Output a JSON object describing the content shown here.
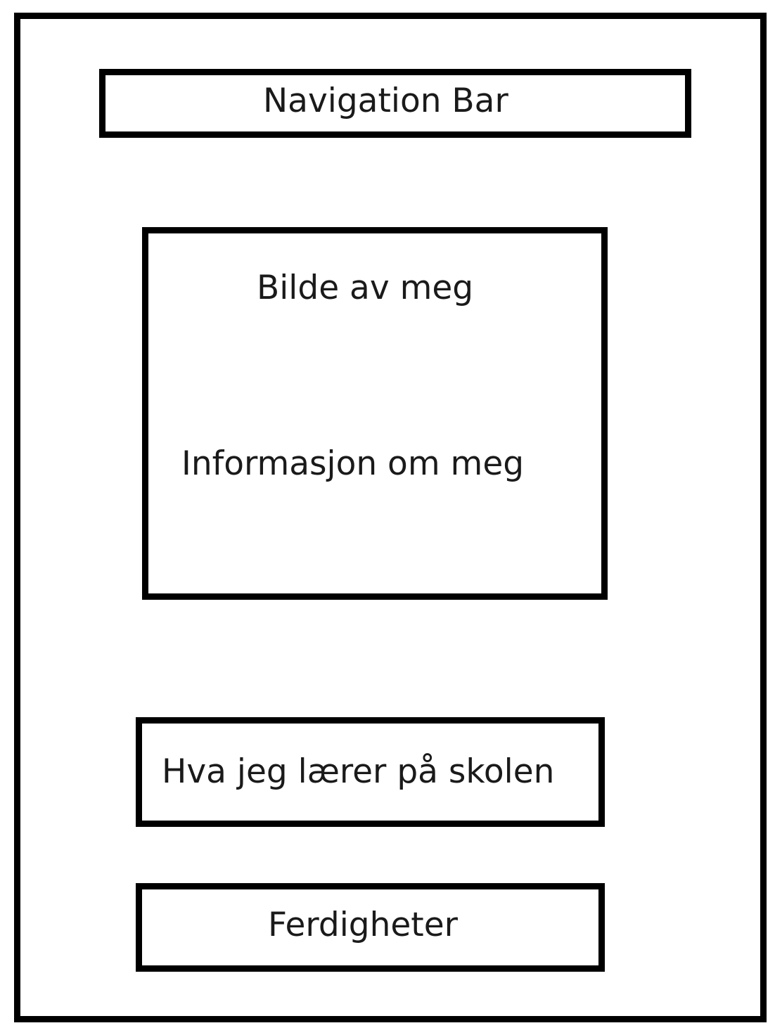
{
  "wireframe": {
    "nav_bar": {
      "label": "Navigation Bar"
    },
    "profile_section": {
      "photo_label": "Bilde av meg",
      "info_label": "Informasjon om meg"
    },
    "school_section": {
      "label": "Hva jeg lærer på skolen"
    },
    "skills_section": {
      "label": "Ferdigheter"
    },
    "colors": {
      "stroke": "#000000",
      "text": "#1a1a1a",
      "background": "#ffffff"
    }
  }
}
